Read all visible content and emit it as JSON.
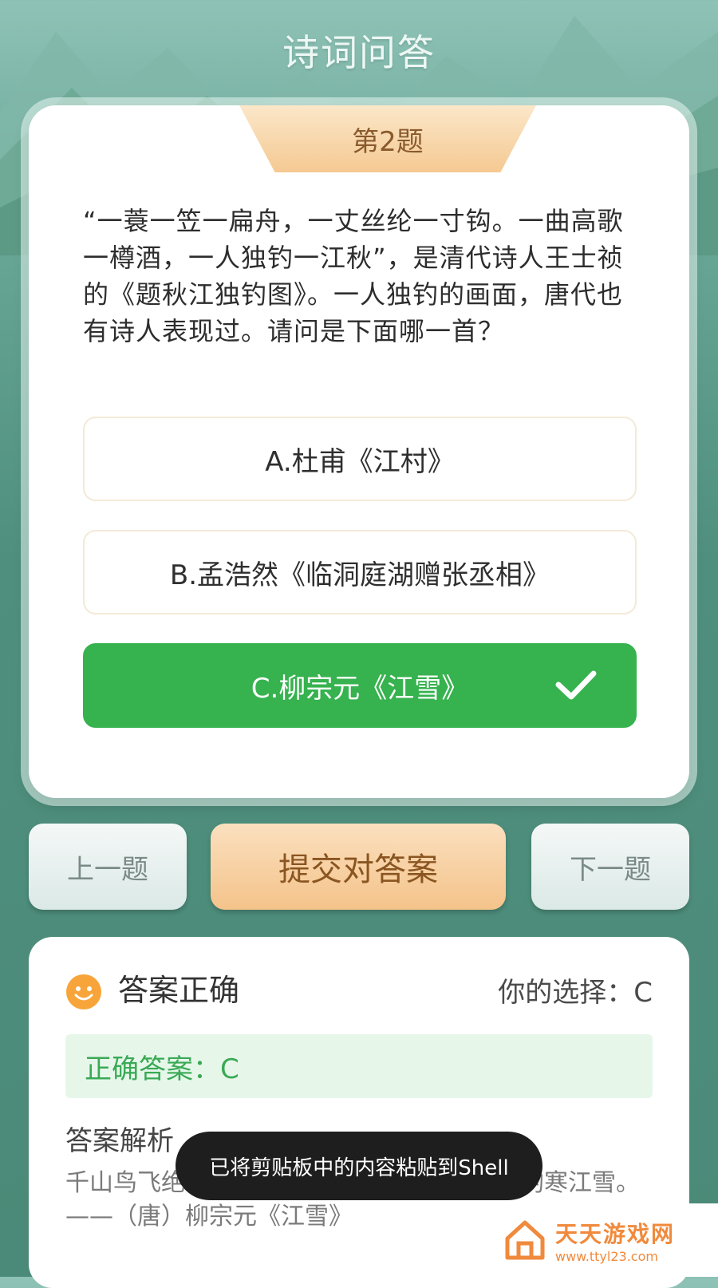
{
  "header": {
    "title": "诗词问答"
  },
  "quiz": {
    "question_number": "第2题",
    "question_text": "“一蓑一笠一扁舟，一丈丝纶一寸钩。一曲高歌一樽酒，一人独钓一江秋”，是清代诗人王士祯的《题秋江独钓图》。一人独钓的画面，唐代也有诗人表现过。请问是下面哪一首？",
    "options": [
      {
        "label": "A.杜甫《江村》",
        "state": "normal"
      },
      {
        "label": "B.孟浩然《临洞庭湖赠张丞相》",
        "state": "normal"
      },
      {
        "label": "C.柳宗元《江雪》",
        "state": "correct"
      }
    ]
  },
  "buttons": {
    "prev": "上一题",
    "submit": "提交对答案",
    "next": "下一题"
  },
  "result": {
    "status": "答案正确",
    "your_choice": "你的选择：C",
    "correct_answer": "正确答案：C",
    "analysis_title": "答案解析",
    "analysis_text": "千山鸟飞绝，万径人踪灭。孤舟蓑笠翁，独钓寒江雪。——（唐）柳宗元《江雪》"
  },
  "toast": {
    "message": "已将剪贴板中的内容粘贴到Shell"
  },
  "watermark": {
    "name": "天天游戏网",
    "url": "www.ttyl23.com"
  },
  "colors": {
    "correct_green": "#36b24e",
    "accent_orange": "#f4c38a",
    "background_teal": "#4f8f7d"
  }
}
